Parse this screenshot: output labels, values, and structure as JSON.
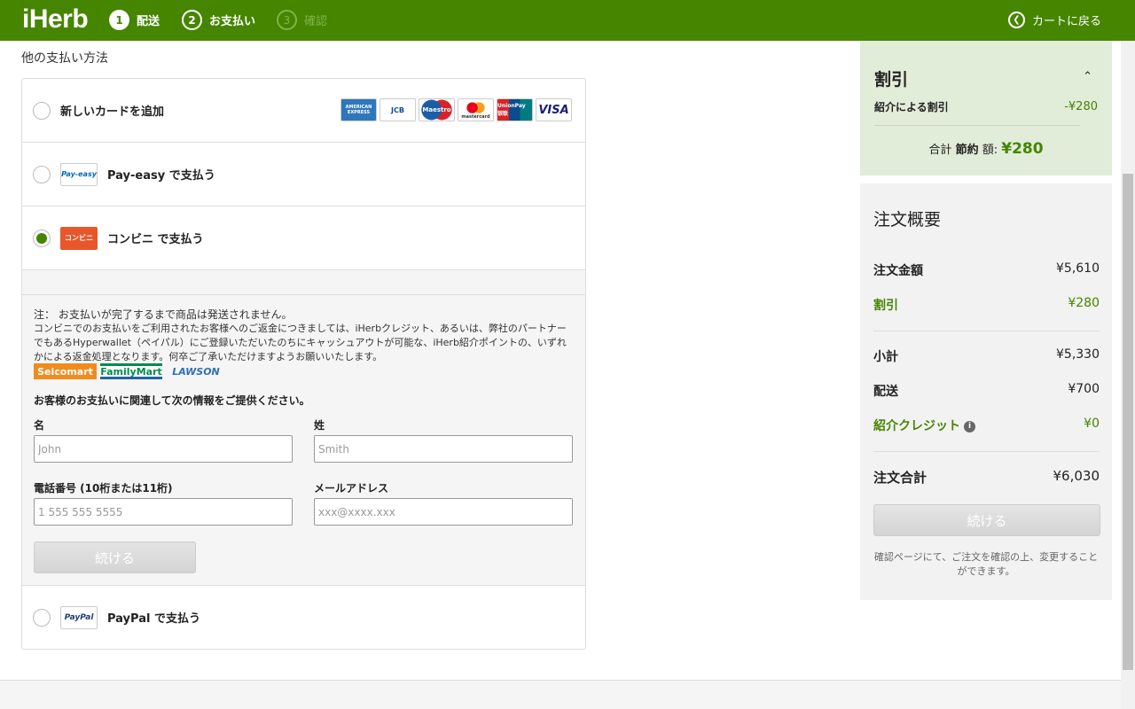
{
  "header": {
    "logo": "iHerb",
    "steps": [
      {
        "num": "1",
        "label": "配送"
      },
      {
        "num": "2",
        "label": "お支払い"
      },
      {
        "num": "3",
        "label": "確認"
      }
    ],
    "back_label": "カートに戻る"
  },
  "payment": {
    "section_title": "他の支払い方法",
    "options": {
      "add_card": "新しいカードを追加",
      "payeasy": "Pay-easy で支払う",
      "konbini": "コンビニ で支払う",
      "paypal": "PayPal で支払う"
    },
    "card_brands": [
      "AMERICAN EXPRESS",
      "JCB",
      "Maestro",
      "mastercard",
      "UnionPay 银联",
      "VISA"
    ],
    "payeasy_logo": "Pay-easy",
    "konbini_logo": "コンビニ",
    "paypal_logo": "PayPal",
    "note_line1": "注： お支払いが完了するまで商品は発送されません。",
    "note_body": "コンビニでのお支払いをご利用されたお客様へのご返金につきましては、iHerbクレジット、あるいは、弊社のパートナーでもあるHyperwallet（ペイパル）にご登録いただいたのちにキャッシュアウトが可能な、iHerb紹介ポイントの、いずれかによる返金処理となります。何卒ご了承いただけますようお願いいたします。",
    "stores": [
      "Seicomart",
      "FamilyMart",
      "LAWSON"
    ],
    "prompt": "お客様のお支払いに関連して次の情報をご提供ください。",
    "fields": {
      "first_name_label": "名",
      "first_name_placeholder": "John",
      "last_name_label": "姓",
      "last_name_placeholder": "Smith",
      "phone_label": "電話番号 (10桁または11桁)",
      "phone_placeholder": "1 555 555 5555",
      "email_label": "メールアドレス",
      "email_placeholder": "xxx@xxxx.xxx"
    },
    "continue_label": "続ける"
  },
  "discount": {
    "title": "割引",
    "referral_label": "紹介による割引",
    "referral_value": "-¥280",
    "total_prefix": "合計",
    "total_bold": "節約",
    "total_suffix": "額:",
    "total_amount": "¥280"
  },
  "summary": {
    "title": "注文概要",
    "order_amount_label": "注文金額",
    "order_amount": "¥5,610",
    "discount_label": "割引",
    "discount_value": "¥280",
    "subtotal_label": "小計",
    "subtotal": "¥5,330",
    "shipping_label": "配送",
    "shipping": "¥700",
    "referral_credit_label": "紹介クレジット",
    "referral_credit": "¥0",
    "total_label": "注文合計",
    "total": "¥6,030",
    "continue_label": "続ける",
    "footnote": "確認ページにて、ご注文を確認の上、変更することができます。"
  },
  "colors": {
    "brand_green": "#458500",
    "discount_bg": "#e1ecd9"
  }
}
